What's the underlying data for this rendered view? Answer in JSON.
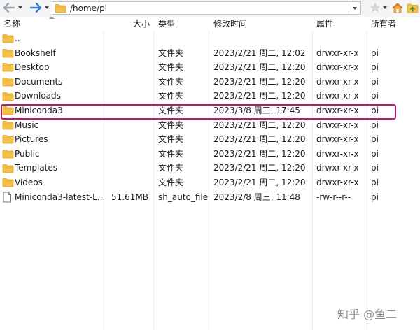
{
  "path_bar": {
    "path": "/home/pi"
  },
  "columns": {
    "name": "名称",
    "size": "大小",
    "type": "类型",
    "mtime": "修改时间",
    "perm": "属性",
    "owner": "所有者"
  },
  "rows": [
    {
      "kind": "folder",
      "name": "..",
      "size": "",
      "type": "",
      "mtime": "",
      "perm": "",
      "owner": ""
    },
    {
      "kind": "folder",
      "name": "Bookshelf",
      "size": "",
      "type": "文件夹",
      "mtime": "2023/2/21 周二, 12:02",
      "perm": "drwxr-xr-x",
      "owner": "pi"
    },
    {
      "kind": "folder",
      "name": "Desktop",
      "size": "",
      "type": "文件夹",
      "mtime": "2023/2/21 周二, 12:20",
      "perm": "drwxr-xr-x",
      "owner": "pi"
    },
    {
      "kind": "folder",
      "name": "Documents",
      "size": "",
      "type": "文件夹",
      "mtime": "2023/2/21 周二, 12:20",
      "perm": "drwxr-xr-x",
      "owner": "pi"
    },
    {
      "kind": "folder",
      "name": "Downloads",
      "size": "",
      "type": "文件夹",
      "mtime": "2023/2/21 周二, 12:20",
      "perm": "drwxr-xr-x",
      "owner": "pi"
    },
    {
      "kind": "folder",
      "name": "Miniconda3",
      "size": "",
      "type": "文件夹",
      "mtime": "2023/3/8 周三, 17:45",
      "perm": "drwxr-xr-x",
      "owner": "pi"
    },
    {
      "kind": "folder",
      "name": "Music",
      "size": "",
      "type": "文件夹",
      "mtime": "2023/2/21 周二, 12:20",
      "perm": "drwxr-xr-x",
      "owner": "pi"
    },
    {
      "kind": "folder",
      "name": "Pictures",
      "size": "",
      "type": "文件夹",
      "mtime": "2023/2/21 周二, 12:20",
      "perm": "drwxr-xr-x",
      "owner": "pi"
    },
    {
      "kind": "folder",
      "name": "Public",
      "size": "",
      "type": "文件夹",
      "mtime": "2023/2/21 周二, 12:20",
      "perm": "drwxr-xr-x",
      "owner": "pi"
    },
    {
      "kind": "folder",
      "name": "Templates",
      "size": "",
      "type": "文件夹",
      "mtime": "2023/2/21 周二, 12:20",
      "perm": "drwxr-xr-x",
      "owner": "pi"
    },
    {
      "kind": "folder",
      "name": "Videos",
      "size": "",
      "type": "文件夹",
      "mtime": "2023/2/21 周二, 12:20",
      "perm": "drwxr-xr-x",
      "owner": "pi"
    },
    {
      "kind": "file",
      "name": "Miniconda3-latest-L...",
      "size": "51.61MB",
      "type": "sh_auto_file",
      "mtime": "2023/2/8 周三, 11:48",
      "perm": "-rw-r--r--",
      "owner": "pi"
    }
  ],
  "icons": {
    "back": "arrow-left-icon",
    "forward": "arrow-right-icon",
    "bookmark": "star-icon",
    "home": "home-icon",
    "up": "parent-folder-icon",
    "folder": "folder-icon",
    "file": "file-icon"
  },
  "colors": {
    "nav_arrow": "#3b7ddd",
    "folder": "#f3c04a",
    "highlight": "#b51d6b"
  },
  "watermark": {
    "text": "知乎 @鱼二"
  }
}
